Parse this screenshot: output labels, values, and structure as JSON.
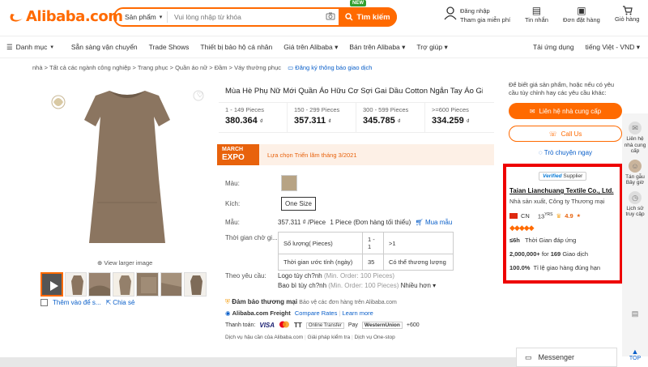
{
  "header": {
    "logo_text": "Alibaba.com",
    "search_category": "Sản phẩm",
    "search_placeholder": "Vui lòng nhập từ khóa",
    "search_button": "Tìm kiếm",
    "new_badge": "NEW",
    "signin_line1": "Đăng nhập",
    "signin_line2": "Tham gia miễn phí",
    "messages": "Tin nhắn",
    "orders": "Đơn đặt hàng",
    "cart": "Giỏ hàng"
  },
  "nav": {
    "categories": "Danh mục",
    "items": [
      "Sẵn sàng vận chuyển",
      "Trade Shows",
      "Thiết bị bảo hộ cá nhân",
      "Giá trên Alibaba",
      "Bán trên Alibaba",
      "Trợ giúp"
    ],
    "app": "Tải ứng dụng",
    "lang": "tiếng Việt - VND"
  },
  "breadcrumbs": [
    "nhà",
    "Tất cả các ngành công nghiệp",
    "Trang phục",
    "Quần áo nữ",
    "Đầm",
    "Váy thường phục"
  ],
  "subscribe_label": "Đăng ký thông báo giao dịch",
  "gallery": {
    "view_larger": "View larger image",
    "compare": "Thêm vào để s...",
    "share": "Chia sẻ"
  },
  "product": {
    "title": "Mùa Hè Phụ Nữ Mới Quần Áo Hữu Cơ Sợi Gai Dầu Cotton Ngắn Tay Áo Giản Dị",
    "tiers": [
      {
        "qty": "1 - 149 Pieces",
        "price": "380.364",
        "unit": "₫"
      },
      {
        "qty": "150 - 299 Pieces",
        "price": "357.311",
        "unit": "₫"
      },
      {
        "qty": "300 - 599 Pieces",
        "price": "345.785",
        "unit": "₫"
      },
      {
        "qty": ">=600 Pieces",
        "price": "334.259",
        "unit": "₫"
      }
    ],
    "expo_line1": "MARCH",
    "expo_line2": "EXPO",
    "expo_text": "Lựa chọn Triển lãm tháng 3/2021",
    "color_label": "Màu:",
    "size_label": "Kích:",
    "size_value": "One Size",
    "sample_label": "Mẫu:",
    "sample_price": "357.311 ₫ /Piece",
    "sample_min": "1 Piece (Đơn hàng tối thiểu)",
    "buy_sample": "Mua mẫu",
    "lead_label": "Thời gian chờ gi...",
    "lead_table": [
      [
        "Số lượng( Pieces)",
        "1 - 1",
        ">1"
      ],
      [
        "Thời gian ước tính (ngày)",
        "35",
        "Có thể thương lượng"
      ]
    ],
    "custom_label": "Theo yêu cầu:",
    "custom_logo": "Logo tùy ch?nh",
    "custom_logo_min": "(Min. Order: 100 Pieces)",
    "custom_pack": "Bao bì tùy ch?nh",
    "custom_pack_min": "(Min. Order: 100 Pieces)",
    "more": "Nhiều hơn",
    "ta_title": "Đảm bảo thương mại",
    "ta_desc": "Bảo vệ các đơn hàng trên Alibaba.com",
    "freight": "Alibaba.com Freight",
    "compare_rates": "Compare Rates",
    "learn_more": "Learn more",
    "payment_label": "Thanh toán:",
    "payments": [
      "VISA",
      "TT",
      "Online Transfer",
      "Pay",
      "WesternUnion",
      "+600"
    ],
    "services": [
      "Dịch vụ hậu cần của Alibaba.com",
      "Giải pháp kiểm tra",
      "Dịch vụ One-stop"
    ]
  },
  "supplier": {
    "intro": "Để biết giá sản phẩm, hoặc nếu có yêu cầu tùy chỉnh hay các yêu cầu khác:",
    "contact_button": "Liên hệ nhà cung cấp",
    "call_button": "Call Us",
    "chat_link": "Trò chuyện ngay",
    "verified": "Verified",
    "supplier_word": "Supplier",
    "name": "Taian Lianchuang Textile Co., Ltd.",
    "type": "Nhà sản xuất, Công ty Thương mại",
    "country": "CN",
    "years": "13",
    "years_unit": "YRS",
    "rating": "4.9",
    "response_time": "≤6h",
    "response_label": "Thời Gian đáp ứng",
    "transactions_amount": "2,000,000+",
    "transactions_count": "169",
    "transactions_label": "Giao dịch",
    "ontime_rate": "100.0%",
    "ontime_label": "Tỉ lệ giao hàng đúng hạn"
  },
  "right_sidebar": {
    "contact": "Liên hệ nhà cung cấp",
    "ask": "Tán gẫu Bây giờ",
    "history": "Lịch sử truy cập"
  },
  "messenger": "Messenger",
  "top": "TOP",
  "colors": {
    "brand": "#ff6a00",
    "highlight_box": "#ee0000",
    "link": "#0a5fc9"
  }
}
